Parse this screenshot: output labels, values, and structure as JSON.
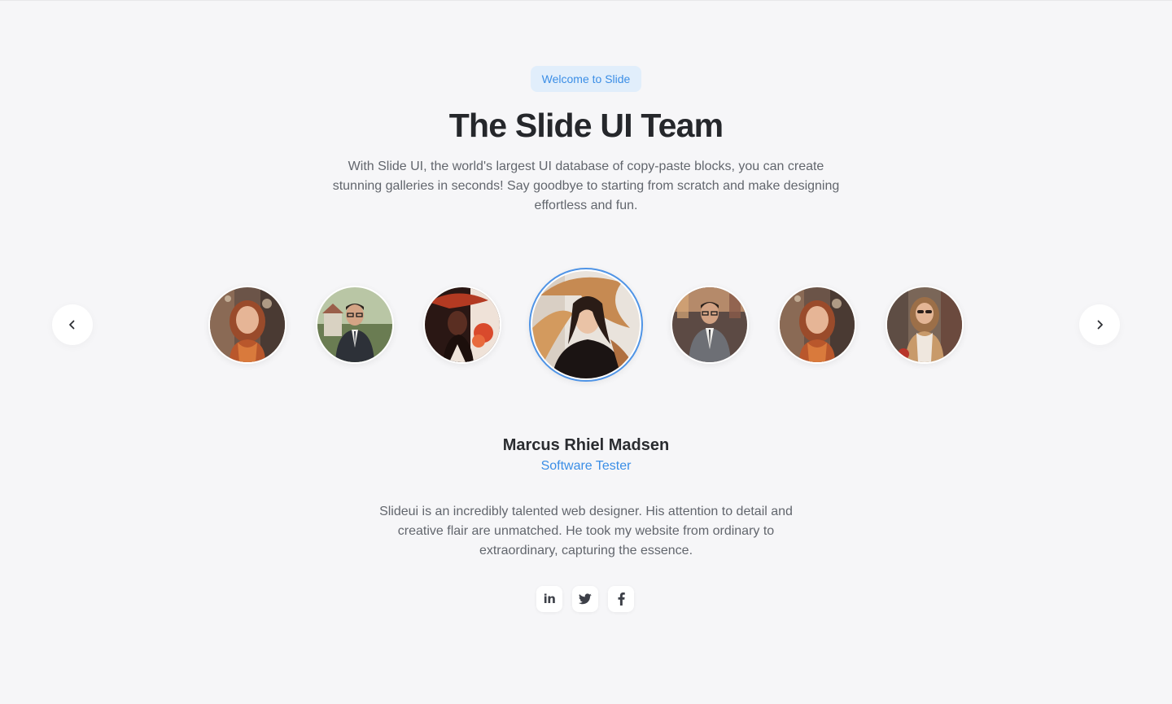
{
  "hero": {
    "badge": "Welcome to Slide",
    "title": "The Slide UI Team",
    "subtitle": "With Slide UI, the world's largest UI database of copy-paste blocks, you can create stunning galleries in seconds! Say goodbye to starting from scratch and make designing effortless and fun."
  },
  "carousel": {
    "prev_icon": "chevron-left-icon",
    "next_icon": "chevron-right-icon",
    "active_index": 3,
    "accent_color": "#4f94e6"
  },
  "member": {
    "name": "Marcus Rhiel Madsen",
    "role": "Software Tester",
    "quote": "Slideui is an incredibly talented web designer. His attention to detail and creative flair are unmatched. He took my website from ordinary to extraordinary, capturing the essence."
  },
  "socials": {
    "linkedin_label": "in",
    "items": [
      "linkedin-icon",
      "twitter-icon",
      "facebook-icon"
    ]
  },
  "colors": {
    "accent": "#3b8ee6",
    "badge_bg": "#e1eefb",
    "background": "#f6f6f8",
    "heading": "#25272b",
    "body_text": "#62666d"
  }
}
